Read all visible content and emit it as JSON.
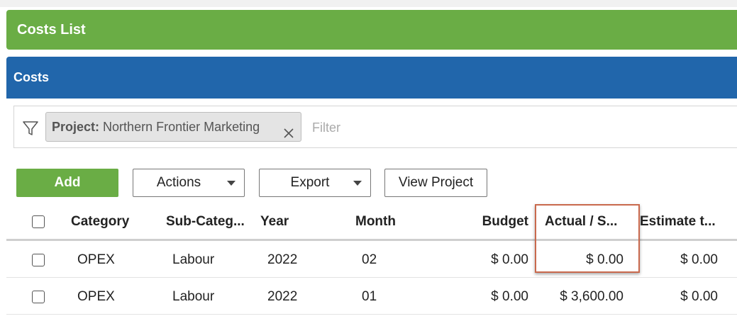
{
  "page": {
    "title": "Costs List"
  },
  "panel": {
    "title": "Costs"
  },
  "filter": {
    "chip_key": "Project:",
    "chip_value": "Northern Frontier Marketing",
    "placeholder": "Filter"
  },
  "toolbar": {
    "add_label": "Add",
    "actions_label": "Actions",
    "export_label": "Export",
    "view_project_label": "View Project"
  },
  "grid": {
    "columns": [
      "Category",
      "Sub-Categ...",
      "Year",
      "Month",
      "Budget",
      "Actual / S...",
      "Estimate t..."
    ],
    "rows": [
      {
        "category": "OPEX",
        "subcategory": "Labour",
        "year": "2022",
        "month": "02",
        "budget": "$ 0.00",
        "actual": "$ 0.00",
        "estimate": "$ 0.00"
      },
      {
        "category": "OPEX",
        "subcategory": "Labour",
        "year": "2022",
        "month": "01",
        "budget": "$ 0.00",
        "actual": "$ 3,600.00",
        "estimate": "$ 0.00"
      }
    ]
  },
  "colors": {
    "header_green": "#6aad45",
    "panel_blue": "#2166ab",
    "highlight_border": "#c9694d"
  }
}
